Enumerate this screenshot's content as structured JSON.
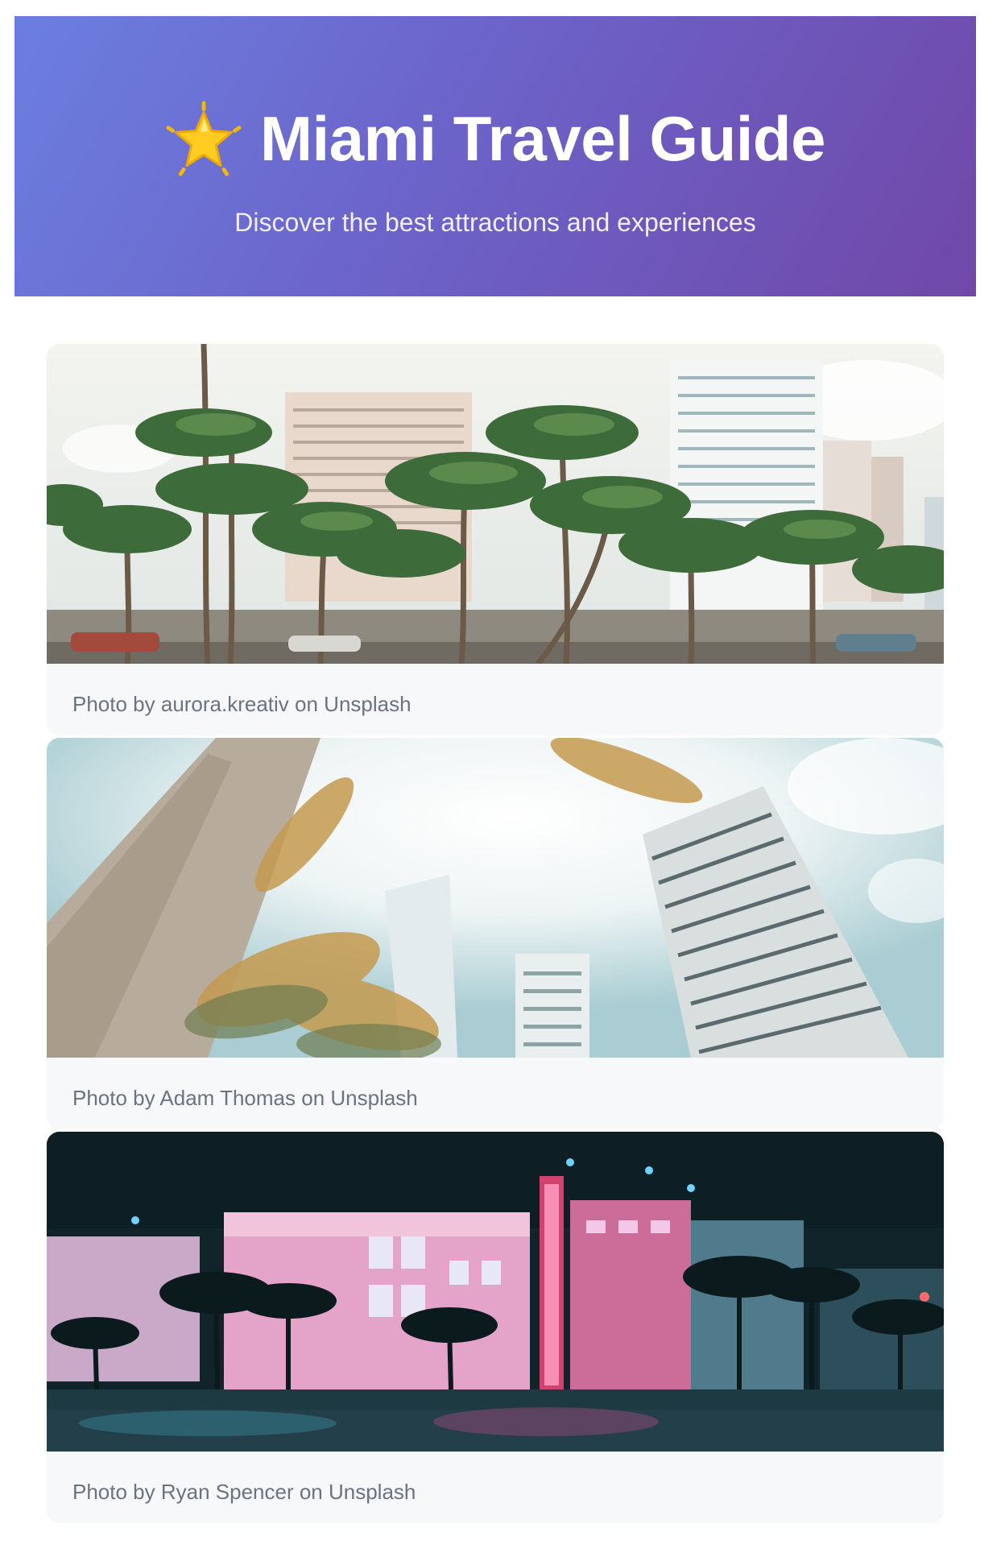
{
  "header": {
    "icon": "star-icon",
    "title": "Miami Travel Guide",
    "subtitle": "Discover the best attractions and experiences",
    "gradient": [
      "#6b7fe0",
      "#7048a8"
    ]
  },
  "gallery": [
    {
      "image": "palm-trees-beachfront-skyline",
      "credit": "Photo by aurora.kreativ on Unsplash"
    },
    {
      "image": "palm-tree-and-high-rise-looking-up",
      "credit": "Photo by Adam Thomas on Unsplash"
    },
    {
      "image": "neon-tropics-hotel-at-night",
      "credit": "Photo by Ryan Spencer on Unsplash"
    }
  ]
}
